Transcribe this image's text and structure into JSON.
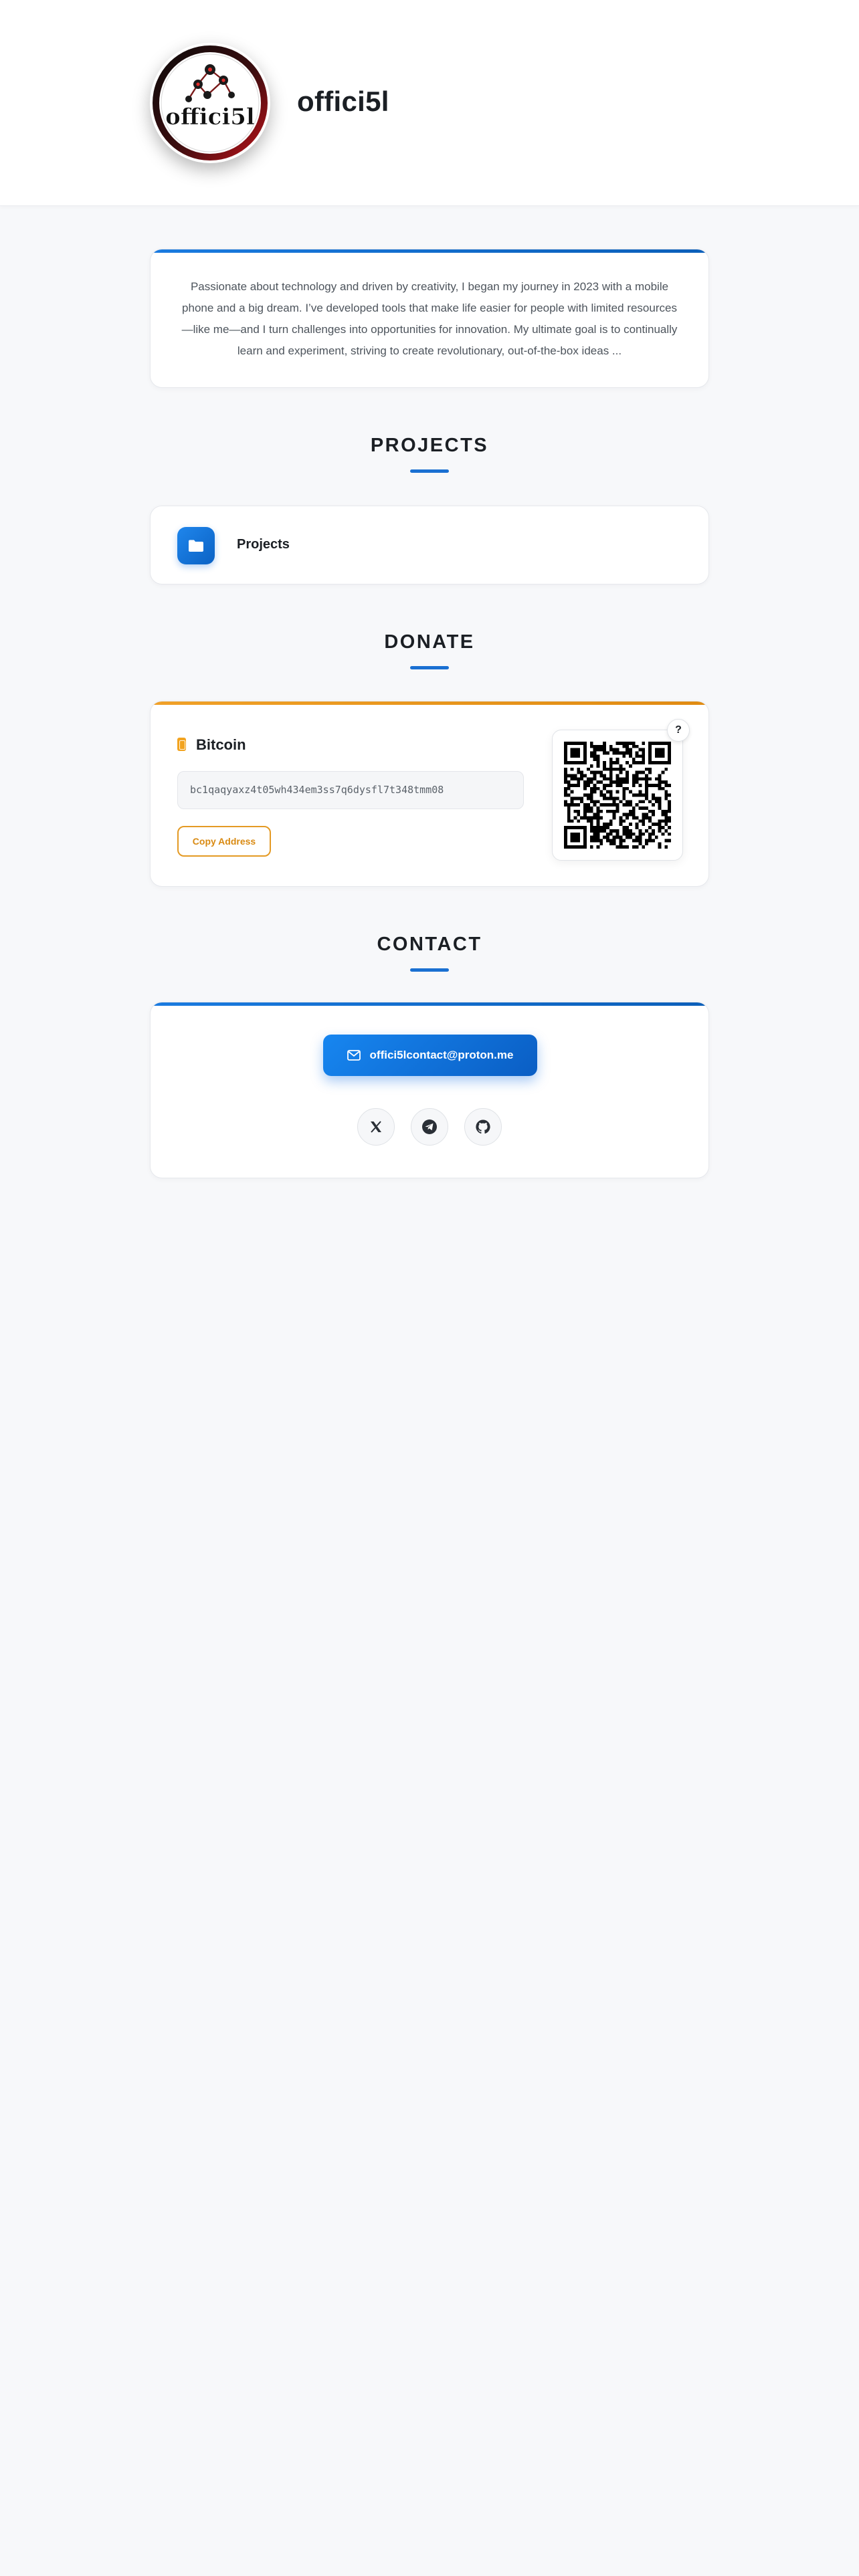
{
  "header": {
    "avatar_alt": "offici5l",
    "site_title": "offici5l"
  },
  "about": {
    "text": "Passionate about technology and driven by creativity, I began my journey in 2023 with a mobile phone and a big dream. I’ve developed tools that make life easier for people with limited resources—like me—and I turn challenges into opportunities for innovation. My ultimate goal is to continually learn and experiment, striving to create revolutionary, out-of-the-box ideas ..."
  },
  "projects": {
    "heading": "PROJECTS",
    "items": [
      {
        "label": "Projects",
        "icon": "folder-icon"
      }
    ]
  },
  "donate": {
    "heading": "DONATE",
    "coin": "Bitcoin",
    "address": "bc1qaqyaxz4t05wh434em3ss7q6dysfl7t348tmm08",
    "copy_label": "Copy Address",
    "help_label": "?"
  },
  "contact": {
    "heading": "CONTACT",
    "email": "offici5lcontact@proton.me",
    "socials": [
      "x-icon",
      "telegram-icon",
      "github-icon"
    ]
  },
  "colors": {
    "accent_blue": "#1a70d2",
    "accent_orange": "#e49a24",
    "background": "#f7f8fa"
  }
}
